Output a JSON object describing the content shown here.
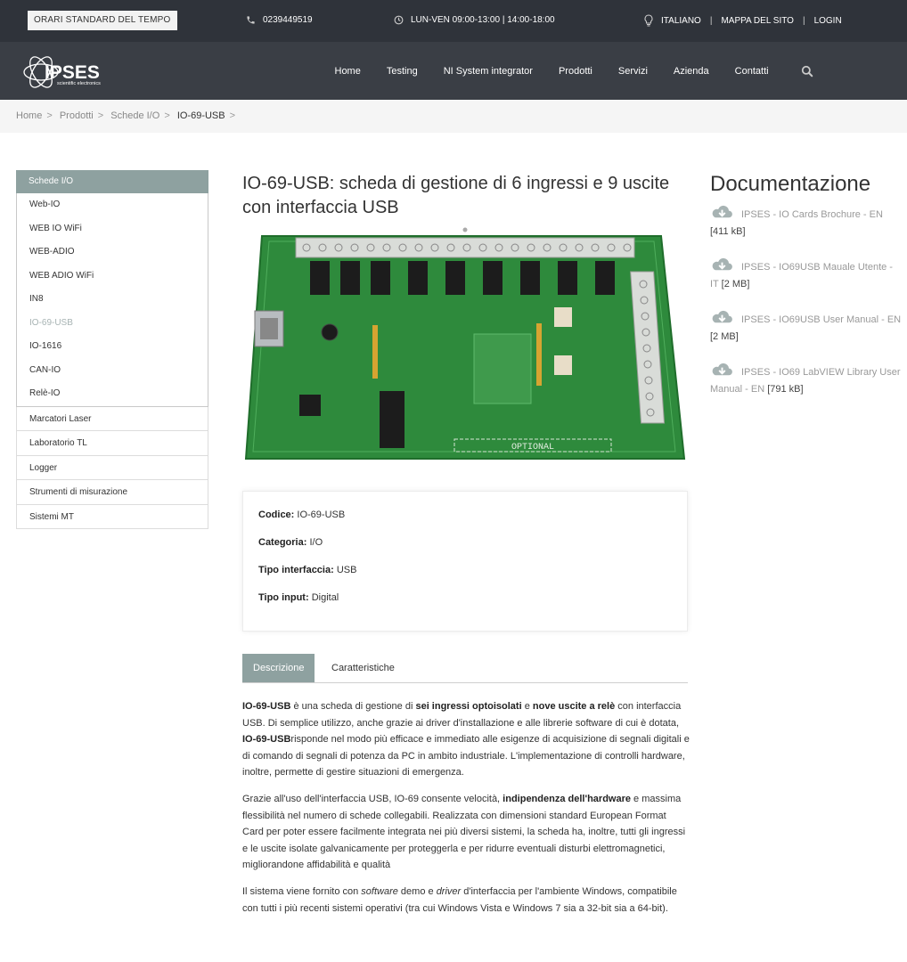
{
  "topbar": {
    "badge": "ORARI STANDARD DEL TEMPO",
    "phone": "0239449519",
    "hours": "LUN-VEN 09:00-13:00 | 14:00-18:00",
    "links": [
      "ITALIANO",
      "MAPPA DEL SITO",
      "LOGIN"
    ]
  },
  "logo": {
    "name": "IPSES",
    "tagline": "scientific electronics"
  },
  "nav": {
    "items": [
      "Home",
      "Testing",
      "NI System integrator",
      "Prodotti",
      "Servizi",
      "Azienda",
      "Contatti"
    ]
  },
  "breadcrumb": [
    "Home",
    "Prodotti",
    "Schede I/O",
    "IO-69-USB"
  ],
  "sidebar": {
    "head": "Schede I/O",
    "sub": [
      "Web-IO",
      "WEB IO WiFi",
      "WEB-ADIO",
      "WEB ADIO WiFi",
      "IN8",
      "IO-69-USB",
      "IO-1616",
      "CAN-IO",
      "Relè-IO"
    ],
    "top": [
      "Marcatori Laser",
      "Laboratorio TL",
      "Logger",
      "Strumenti di misurazione",
      "Sistemi MT"
    ]
  },
  "product": {
    "title": "IO-69-USB: scheda di gestione di 6 ingressi e 9 uscite con interfaccia USB",
    "pcb_optional": "OPTIONAL"
  },
  "specs": [
    {
      "label": "Codice:",
      "value": "IO-69-USB"
    },
    {
      "label": "Categoria:",
      "value": "I/O"
    },
    {
      "label": "Tipo interfaccia:",
      "value": "USB"
    },
    {
      "label": "Tipo input:",
      "value": "Digital"
    }
  ],
  "tabs": [
    "Descrizione",
    "Caratteristiche"
  ],
  "description": {
    "p1": {
      "b1": "IO-69-USB",
      "t1": " è una scheda di gestione di ",
      "b2": "sei ingressi optoisolati",
      "t2": " e ",
      "b3": "nove uscite a relè",
      "t3": " con interfaccia USB. Di semplice utilizzo, anche grazie ai driver d'installazione e alle librerie software di cui è dotata, ",
      "b4": "IO-69-USB",
      "t4": "risponde nel modo più efficace e immediato alle esigenze di acquisizione di segnali digitali e di comando di segnali di potenza da PC in ambito industriale. L'implementazione di controlli hardware, inoltre, permette di gestire situazioni di emergenza."
    },
    "p2": {
      "t1": "Grazie all'uso dell'interfaccia USB, IO-69 consente velocità, ",
      "b1": "indipendenza dell'hardware",
      "t2": " e massima flessibilità nel numero di schede collegabili. Realizzata con dimensioni standard European Format Card per poter essere facilmente integrata nei più diversi sistemi, la scheda ha, inoltre, tutti gli ingressi e le uscite isolate galvanicamente per proteggerla e per ridurre eventuali disturbi elettromagnetici, migliorandone affidabilità e qualità"
    },
    "p3": {
      "t1": "Il sistema viene fornito con ",
      "i1": "software",
      "t2": " demo e ",
      "i2": "driver",
      "t3": " d'interfaccia per l'ambiente Windows, compatibile con tutti i più recenti sistemi operativi (tra cui Windows Vista e Windows 7 sia a 32-bit sia a 64-bit)."
    }
  },
  "docs": {
    "title": "Documentazione",
    "items": [
      {
        "name": "IPSES - IO Cards Brochure - EN",
        "size": "[411 kB]"
      },
      {
        "name": "IPSES - IO69USB Mauale Utente - IT",
        "size": "[2 MB]"
      },
      {
        "name": "IPSES - IO69USB User Manual - EN",
        "size": "[2 MB]"
      },
      {
        "name": "IPSES - IO69 LabVIEW Library User Manual - EN",
        "size": "[791 kB]"
      }
    ]
  },
  "colors": {
    "topbar": "#2f333a",
    "navbar": "#3a3e45",
    "accent": "#8ea1a0",
    "pcb": "#2e8a3c"
  }
}
